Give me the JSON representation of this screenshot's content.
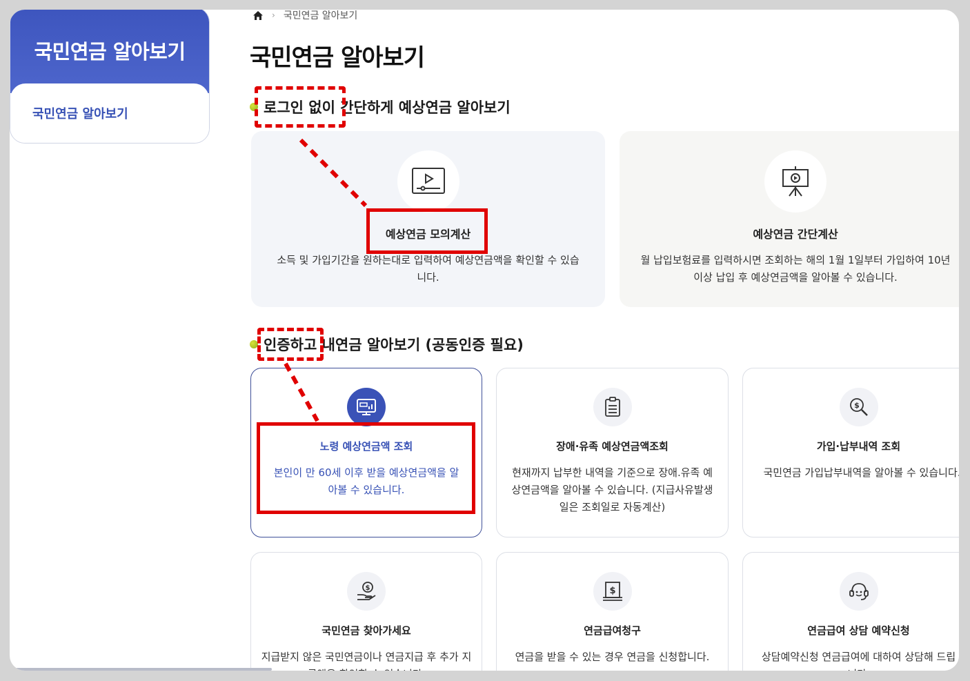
{
  "sidebar": {
    "heading": "국민연금 알아보기",
    "items": [
      {
        "label": "국민연금 알아보기"
      }
    ]
  },
  "breadcrumb": {
    "current": "국민연금 알아보기"
  },
  "page_title": "국민연금 알아보기",
  "section1": {
    "title": "로그인 없이 간단하게 예상연금 알아보기",
    "cards": [
      {
        "icon": "video-player-icon",
        "title": "예상연금 모의계산",
        "desc": "소득 및 가입기간을 원하는대로 입력하여 예상연금액을 확인할 수 있습니다."
      },
      {
        "icon": "presentation-screen-icon",
        "title": "예상연금 간단계산",
        "desc": "월 납입보험료를 입력하시면 조회하는 해의 1월 1일부터 가입하여 10년 이상 납입 후 예상연금액을 알아볼 수 있습니다."
      }
    ]
  },
  "section2": {
    "title": "인증하고 내연금 알아보기 (공동인증 필요)",
    "cards": [
      {
        "icon": "monitor-chart-icon",
        "title": "노령 예상연금액 조회",
        "desc": "본인이 만 60세 이후 받을 예상연금액을 알아볼 수 있습니다."
      },
      {
        "icon": "clipboard-icon",
        "title": "장애·유족 예상연금액조회",
        "desc": "현재까지 납부한 내역을 기준으로 장애.유족 예상연금액을 알아볼 수 있습니다. (지급사유발생일은 조회일로 자동계산)"
      },
      {
        "icon": "magnifier-dollar-icon",
        "title": "가입·납부내역 조회",
        "desc": "국민연금 가입납부내역을 알아볼 수 있습니다."
      },
      {
        "icon": "hand-coin-icon",
        "title": "국민연금 찾아가세요",
        "desc": "지급받지 않은 국민연금이나 연금지급 후 추가 지급액을 확인할 수 있습니다."
      },
      {
        "icon": "bank-dollar-icon",
        "title": "연금급여청구",
        "desc": "연금을 받을 수 있는 경우 연금을 신청합니다."
      },
      {
        "icon": "headset-icon",
        "title": "연금급여 상담 예약신청",
        "desc": "상담예약신청 연금급여에 대하여 상담해 드립니다."
      }
    ]
  },
  "colors": {
    "accent": "#3a52b7",
    "annotation": "#e00000"
  }
}
